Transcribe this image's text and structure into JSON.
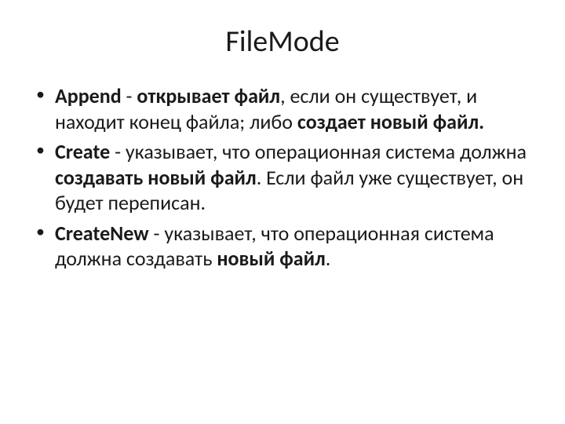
{
  "title": "FileMode",
  "items": [
    {
      "keyword": "Append",
      "sep": " - ",
      "bold1": "открывает файл",
      "text1": ", если он существует, и находит конец файла; либо ",
      "bold2": "создает новый файл."
    },
    {
      "keyword": "Create",
      "sep": " - ",
      "text1": "указывает, что операционная система должна ",
      "bold1": "создавать новый файл",
      "text2": ". Если файл уже существует, он будет переписан."
    },
    {
      "keyword": "CreateNew",
      "sep": " - ",
      "text1": "указывает, что операционная система должна создавать ",
      "bold1": "новый файл",
      "text2": "."
    }
  ]
}
